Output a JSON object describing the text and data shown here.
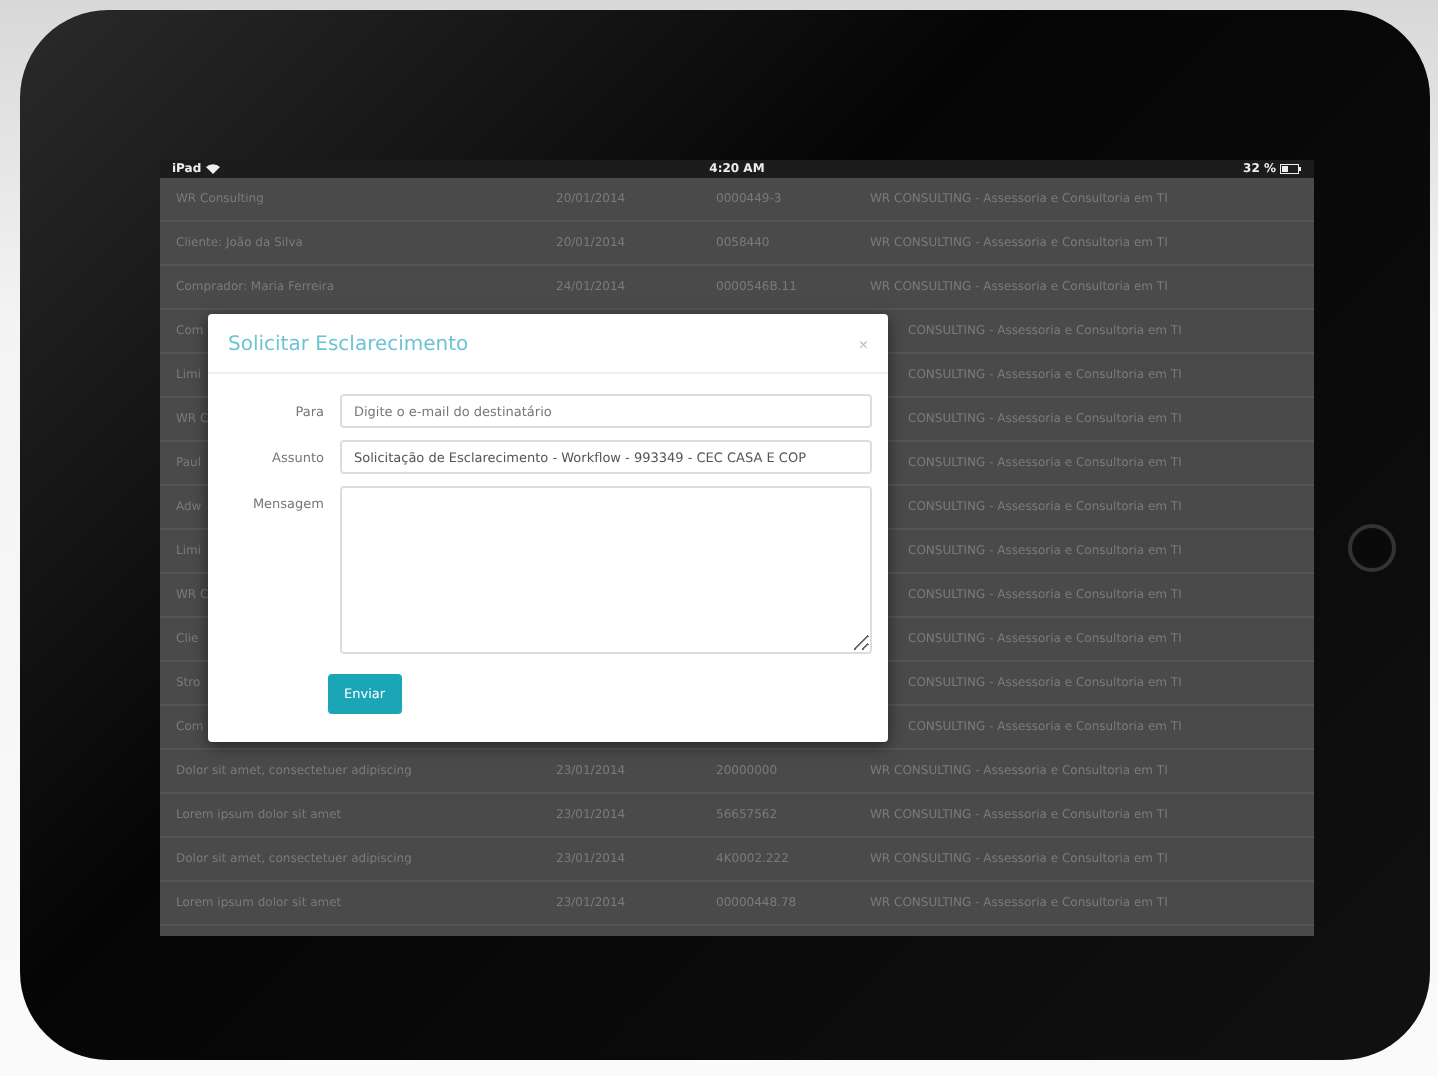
{
  "status_bar": {
    "device": "iPad",
    "time": "4:20 AM",
    "battery": "32 %"
  },
  "table": {
    "rows": [
      {
        "kind": "full",
        "cells": [
          "WR Consulting",
          "20/01/2014",
          "0000449-3",
          "WR CONSULTING - Assessoria e Consultoria em TI"
        ]
      },
      {
        "kind": "full",
        "cells": [
          "Cliente: João da Silva",
          "20/01/2014",
          "0058440",
          "WR CONSULTING - Assessoria e Consultoria em TI"
        ]
      },
      {
        "kind": "full",
        "cells": [
          "Comprador: Maria Ferreira",
          "24/01/2014",
          "0000546B.11",
          "WR CONSULTING - Assessoria e Consultoria em TI"
        ]
      },
      {
        "kind": "covered",
        "cells": [
          "Com",
          "CONSULTING - Assessoria e Consultoria em TI"
        ]
      },
      {
        "kind": "covered",
        "cells": [
          "Limi",
          "CONSULTING - Assessoria e Consultoria em TI"
        ]
      },
      {
        "kind": "covered",
        "cells": [
          "WR C",
          "CONSULTING - Assessoria e Consultoria em TI"
        ]
      },
      {
        "kind": "covered",
        "cells": [
          "Paul",
          "CONSULTING - Assessoria e Consultoria em TI"
        ]
      },
      {
        "kind": "covered",
        "cells": [
          "Adw",
          "CONSULTING - Assessoria e Consultoria em TI"
        ]
      },
      {
        "kind": "covered",
        "cells": [
          "Limi",
          "CONSULTING - Assessoria e Consultoria em TI"
        ]
      },
      {
        "kind": "covered",
        "cells": [
          "WR C",
          "CONSULTING - Assessoria e Consultoria em TI"
        ]
      },
      {
        "kind": "covered",
        "cells": [
          "Clie",
          "CONSULTING - Assessoria e Consultoria em TI"
        ]
      },
      {
        "kind": "covered",
        "cells": [
          "Stro",
          "CONSULTING - Assessoria e Consultoria em TI"
        ]
      },
      {
        "kind": "covered",
        "cells": [
          "Com",
          "CONSULTING - Assessoria e Consultoria em TI"
        ]
      },
      {
        "kind": "full",
        "cells": [
          "Dolor sit amet, consectetuer adipiscing",
          "23/01/2014",
          "20000000",
          "WR CONSULTING - Assessoria e Consultoria em TI"
        ]
      },
      {
        "kind": "full",
        "cells": [
          "Lorem ipsum dolor sit amet",
          "23/01/2014",
          "56657562",
          "WR CONSULTING - Assessoria e Consultoria em TI"
        ]
      },
      {
        "kind": "full",
        "cells": [
          "Dolor sit amet, consectetuer adipiscing",
          "23/01/2014",
          "4K0002.222",
          "WR CONSULTING - Assessoria e Consultoria em TI"
        ]
      },
      {
        "kind": "full",
        "cells": [
          "Lorem ipsum dolor sit amet",
          "23/01/2014",
          "00000448.78",
          "WR CONSULTING - Assessoria e Consultoria em TI"
        ]
      }
    ]
  },
  "modal": {
    "title": "Solicitar Esclarecimento",
    "close": "×",
    "fields": [
      {
        "kind": "input",
        "label": "Para",
        "placeholder": "Digite o e-mail do destinatário"
      },
      {
        "kind": "input",
        "label": "Assunto",
        "value": "Solicitação de Esclarecimento - Workflow - 993349 - CEC CASA E COP"
      },
      {
        "kind": "textarea",
        "label": "Mensagem"
      }
    ],
    "button": "Enviar"
  }
}
